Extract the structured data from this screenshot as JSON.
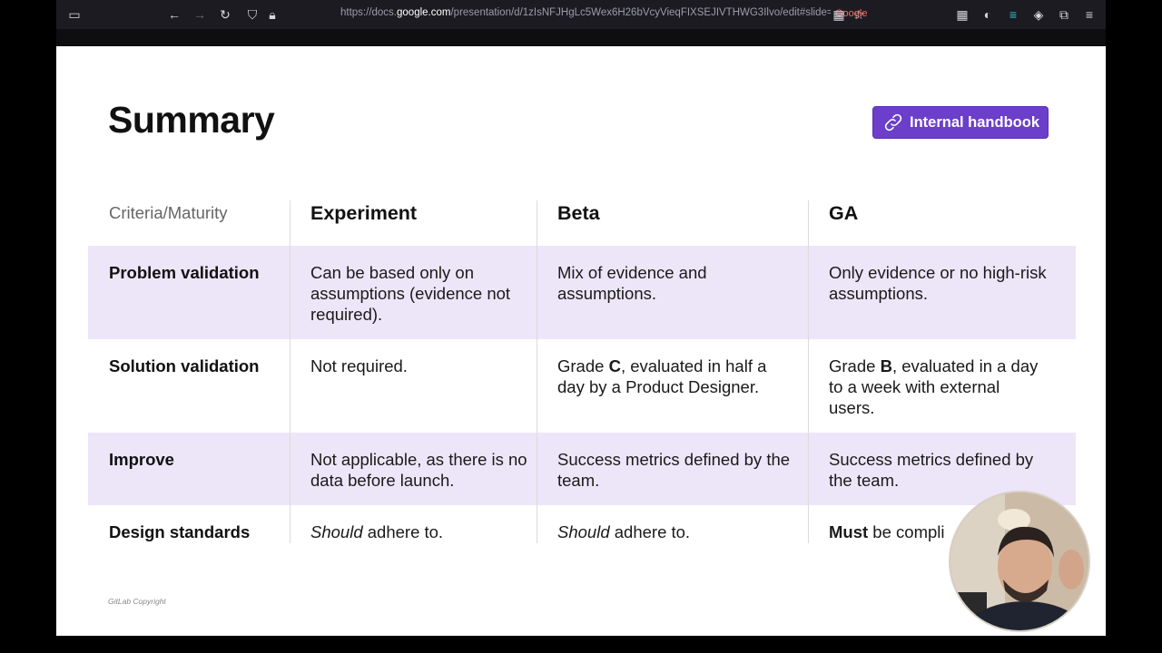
{
  "browser": {
    "url_prefix": "https://docs.",
    "url_host": "google.com",
    "url_rest": "/presentation/d/1zIsNFJHgLc5Wex6H26bVcyVieqFIXSEJIVTHWG3Ilvo/edit#slide=id",
    "badge": "Google"
  },
  "slide": {
    "title": "Summary",
    "handbook_label": "Internal handbook",
    "copyright": "GitLab Copyright"
  },
  "table": {
    "corner": "Criteria/Maturity",
    "columns": [
      "Experiment",
      "Beta",
      "GA"
    ],
    "rows": [
      {
        "label": "Problem validation",
        "cells": [
          [
            {
              "t": "Can be based only on assumptions (evidence not required)."
            }
          ],
          [
            {
              "t": "Mix of evidence and assumptions."
            }
          ],
          [
            {
              "t": "Only evidence or no high-risk assumptions."
            }
          ]
        ]
      },
      {
        "label": "Solution validation",
        "cells": [
          [
            {
              "t": "Not required."
            }
          ],
          [
            {
              "t": "Grade "
            },
            {
              "t": "C",
              "b": true
            },
            {
              "t": ", evaluated in half a day by a Product Designer."
            }
          ],
          [
            {
              "t": "Grade "
            },
            {
              "t": "B",
              "b": true
            },
            {
              "t": ", evaluated in a day to a week with external users."
            }
          ]
        ]
      },
      {
        "label": "Improve",
        "cells": [
          [
            {
              "t": "Not applicable, as there is no data before launch."
            }
          ],
          [
            {
              "t": "Success metrics defined by the team."
            }
          ],
          [
            {
              "t": "Success metrics defined by the team."
            }
          ]
        ]
      },
      {
        "label": "Design standards",
        "cells": [
          [
            {
              "t": "Should",
              "i": true
            },
            {
              "t": " adhere to."
            }
          ],
          [
            {
              "t": "Should",
              "i": true
            },
            {
              "t": " adhere to."
            }
          ],
          [
            {
              "t": "Must",
              "b": true
            },
            {
              "t": " be compli"
            }
          ]
        ]
      }
    ]
  },
  "colors": {
    "accent": "#6b3fc9",
    "row_highlight": "#ede5f8"
  }
}
